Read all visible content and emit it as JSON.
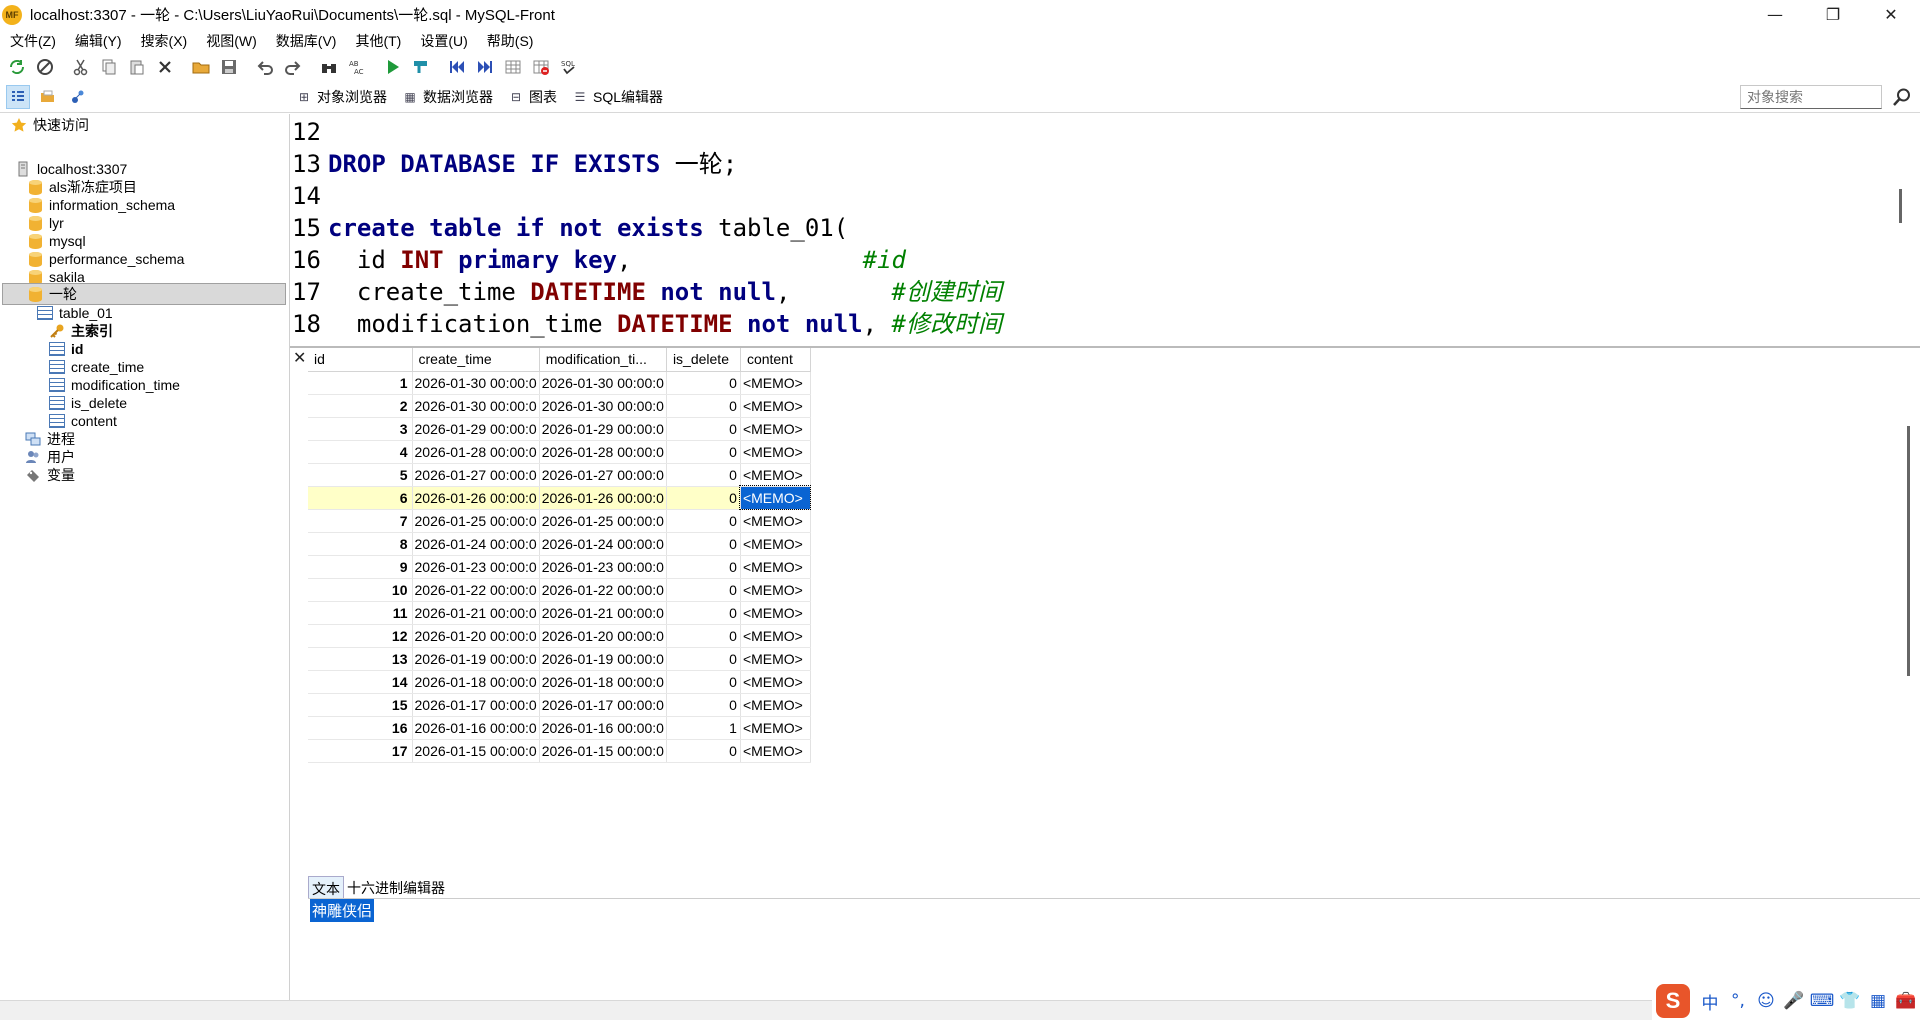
{
  "window": {
    "title": "localhost:3307 - 一轮 - C:\\Users\\LiuYaoRui\\Documents\\一轮.sql - MySQL-Front",
    "logo": "MF",
    "minimize": "—",
    "restore": "❐",
    "close": "✕"
  },
  "menu": [
    "文件(Z)",
    "编辑(Y)",
    "搜索(X)",
    "视图(W)",
    "数据库(V)",
    "其他(T)",
    "设置(U)",
    "帮助(S)"
  ],
  "toolbar_icons": [
    "refresh-icon",
    "stop-icon",
    "cut-icon",
    "copy-icon",
    "paste-icon",
    "delete-icon",
    "open-folder-icon",
    "save-icon",
    "undo-icon",
    "redo-icon",
    "find-icon",
    "replace-icon",
    "run-icon",
    "run-selection-icon",
    "first-record-icon",
    "last-record-icon",
    "grid-icon",
    "grid-delete-icon",
    "sql-check-icon"
  ],
  "view_tabs": [
    "对象浏览器",
    "数据浏览器",
    "图表",
    "SQL编辑器"
  ],
  "search": {
    "placeholder": "对象搜索"
  },
  "tree": {
    "quick_access": "快速访问",
    "server": "localhost:3307",
    "databases": [
      "als渐冻症项目",
      "information_schema",
      "lyr",
      "mysql",
      "performance_schema",
      "sakila",
      "一轮"
    ],
    "table": "table_01",
    "primary_key": "主索引",
    "columns": [
      "id",
      "create_time",
      "modification_time",
      "is_delete",
      "content"
    ],
    "others": [
      "进程",
      "用户",
      "变量"
    ]
  },
  "editor": {
    "lines": [
      {
        "n": "12",
        "parts": []
      },
      {
        "n": "13",
        "parts": [
          [
            "kw",
            "DROP DATABASE IF EXISTS"
          ],
          [
            "tx",
            " 一轮;"
          ]
        ]
      },
      {
        "n": "14",
        "parts": []
      },
      {
        "n": "15",
        "parts": [
          [
            "kw",
            "create table if not exists"
          ],
          [
            "tx",
            " table_01("
          ]
        ]
      },
      {
        "n": "16",
        "parts": [
          [
            "tx",
            "  id "
          ],
          [
            "ty",
            "INT"
          ],
          [
            "tx",
            " "
          ],
          [
            "kw",
            "primary key"
          ],
          [
            "tx",
            ",                "
          ],
          [
            "cm",
            "#id"
          ]
        ]
      },
      {
        "n": "17",
        "parts": [
          [
            "tx",
            "  create_time "
          ],
          [
            "ty",
            "DATETIME"
          ],
          [
            "tx",
            " "
          ],
          [
            "kw",
            "not null"
          ],
          [
            "tx",
            ",       "
          ],
          [
            "cm",
            "#创建时间"
          ]
        ]
      },
      {
        "n": "18",
        "parts": [
          [
            "tx",
            "  modification_time "
          ],
          [
            "ty",
            "DATETIME"
          ],
          [
            "tx",
            " "
          ],
          [
            "kw",
            "not null"
          ],
          [
            "tx",
            ", "
          ],
          [
            "cm",
            "#修改时间"
          ]
        ]
      }
    ]
  },
  "grid": {
    "close": "✕",
    "headers": [
      "id",
      "create_time",
      "modification_ti...",
      "is_delete",
      "content"
    ],
    "rows": [
      [
        "1",
        "2026-01-30 00:00:0",
        "2026-01-30 00:00:0",
        "0",
        "<MEMO>"
      ],
      [
        "2",
        "2026-01-30 00:00:0",
        "2026-01-30 00:00:0",
        "0",
        "<MEMO>"
      ],
      [
        "3",
        "2026-01-29 00:00:0",
        "2026-01-29 00:00:0",
        "0",
        "<MEMO>"
      ],
      [
        "4",
        "2026-01-28 00:00:0",
        "2026-01-28 00:00:0",
        "0",
        "<MEMO>"
      ],
      [
        "5",
        "2026-01-27 00:00:0",
        "2026-01-27 00:00:0",
        "0",
        "<MEMO>"
      ],
      [
        "6",
        "2026-01-26 00:00:0",
        "2026-01-26 00:00:0",
        "0",
        "<MEMO>"
      ],
      [
        "7",
        "2026-01-25 00:00:0",
        "2026-01-25 00:00:0",
        "0",
        "<MEMO>"
      ],
      [
        "8",
        "2026-01-24 00:00:0",
        "2026-01-24 00:00:0",
        "0",
        "<MEMO>"
      ],
      [
        "9",
        "2026-01-23 00:00:0",
        "2026-01-23 00:00:0",
        "0",
        "<MEMO>"
      ],
      [
        "10",
        "2026-01-22 00:00:0",
        "2026-01-22 00:00:0",
        "0",
        "<MEMO>"
      ],
      [
        "11",
        "2026-01-21 00:00:0",
        "2026-01-21 00:00:0",
        "0",
        "<MEMO>"
      ],
      [
        "12",
        "2026-01-20 00:00:0",
        "2026-01-20 00:00:0",
        "0",
        "<MEMO>"
      ],
      [
        "13",
        "2026-01-19 00:00:0",
        "2026-01-19 00:00:0",
        "0",
        "<MEMO>"
      ],
      [
        "14",
        "2026-01-18 00:00:0",
        "2026-01-18 00:00:0",
        "0",
        "<MEMO>"
      ],
      [
        "15",
        "2026-01-17 00:00:0",
        "2026-01-17 00:00:0",
        "0",
        "<MEMO>"
      ],
      [
        "16",
        "2026-01-16 00:00:0",
        "2026-01-16 00:00:0",
        "1",
        "<MEMO>"
      ],
      [
        "17",
        "2026-01-15 00:00:0",
        "2026-01-15 00:00:0",
        "0",
        "<MEMO>"
      ]
    ],
    "selected_row": 5
  },
  "memo": {
    "tabs": [
      "文本",
      "十六进制编辑器"
    ],
    "content": "神雕侠侣"
  },
  "ime": {
    "logo": "S",
    "items": [
      "中",
      "°,",
      "☺",
      "🎤",
      "⌨",
      "👕",
      "▦",
      "🧰"
    ]
  },
  "colors": {
    "keyword": "#00007f",
    "type": "#800000",
    "comment": "#008000",
    "selection": "#0a64d2",
    "highlight_row": "#ffffc8"
  }
}
